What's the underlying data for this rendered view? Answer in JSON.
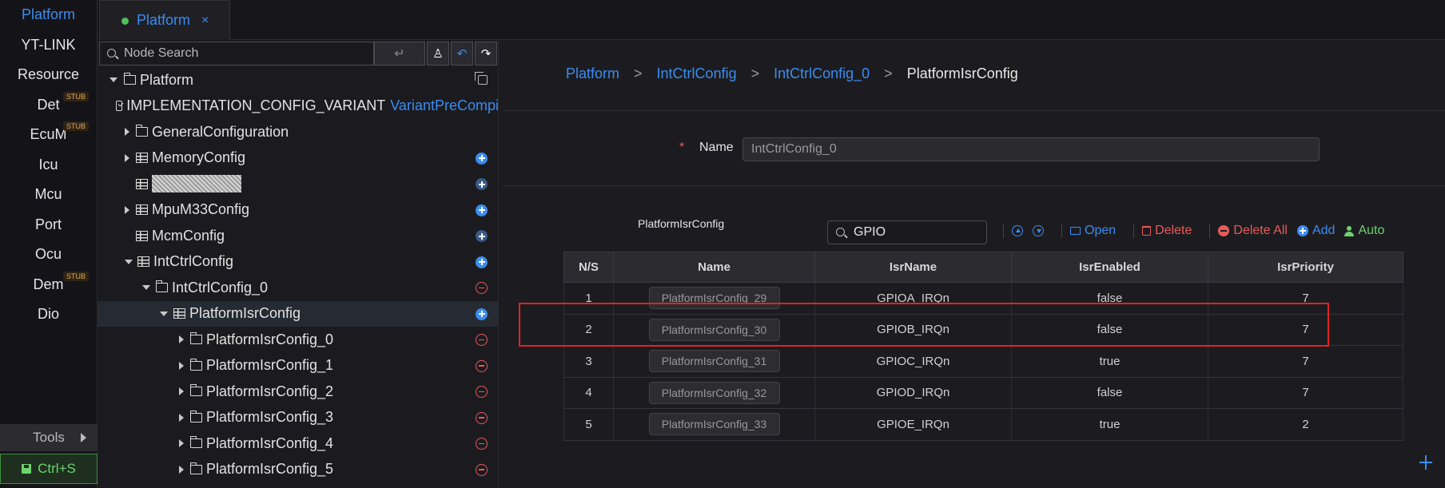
{
  "rail": {
    "items": [
      {
        "label": "Platform",
        "stub": ""
      },
      {
        "label": "YT-LINK",
        "stub": ""
      },
      {
        "label": "Resource",
        "stub": ""
      },
      {
        "label": "Det",
        "stub": "STUB"
      },
      {
        "label": "EcuM",
        "stub": "STUB"
      },
      {
        "label": "Icu",
        "stub": ""
      },
      {
        "label": "Mcu",
        "stub": ""
      },
      {
        "label": "Port",
        "stub": ""
      },
      {
        "label": "Ocu",
        "stub": ""
      },
      {
        "label": "Dem",
        "stub": "STUB"
      },
      {
        "label": "Dio",
        "stub": ""
      }
    ],
    "tools_label": "Tools",
    "save_label": "Ctrl+S"
  },
  "tabs": [
    {
      "label": "Platform",
      "close": "×"
    }
  ],
  "tree_panel": {
    "search_placeholder": "Node Search",
    "enter_glyph": "↵",
    "tree": [
      {
        "label": "Platform",
        "value": "",
        "caret": "down",
        "icon": "folder",
        "action": "copy"
      },
      {
        "label": "IMPLEMENTATION_CONFIG_VARIANT",
        "value": "VariantPreCompi",
        "caret": "",
        "icon": "check",
        "action": ""
      },
      {
        "label": "GeneralConfiguration",
        "value": "",
        "caret": "right",
        "icon": "folder",
        "action": ""
      },
      {
        "label": "MemoryConfig",
        "value": "",
        "caret": "right",
        "icon": "table",
        "action": "add"
      },
      {
        "label": "",
        "value": "",
        "caret": "",
        "icon": "table",
        "action": "add-dim"
      },
      {
        "label": "MpuM33Config",
        "value": "",
        "caret": "right",
        "icon": "table",
        "action": "add"
      },
      {
        "label": "McmConfig",
        "value": "",
        "caret": "",
        "icon": "table",
        "action": "add-dim"
      },
      {
        "label": "IntCtrlConfig",
        "value": "",
        "caret": "down",
        "icon": "table",
        "action": "add"
      },
      {
        "label": "IntCtrlConfig_0",
        "value": "",
        "caret": "down",
        "icon": "folder",
        "action": "remove"
      },
      {
        "label": "PlatformIsrConfig",
        "value": "",
        "caret": "down",
        "icon": "table",
        "action": "add"
      },
      {
        "label": "PlatformIsrConfig_0",
        "value": "",
        "caret": "right",
        "icon": "folder",
        "action": "remove"
      },
      {
        "label": "PlatformIsrConfig_1",
        "value": "",
        "caret": "right",
        "icon": "folder",
        "action": "remove"
      },
      {
        "label": "PlatformIsrConfig_2",
        "value": "",
        "caret": "right",
        "icon": "folder",
        "action": "remove"
      },
      {
        "label": "PlatformIsrConfig_3",
        "value": "",
        "caret": "right",
        "icon": "folder",
        "action": "remove"
      },
      {
        "label": "PlatformIsrConfig_4",
        "value": "",
        "caret": "right",
        "icon": "folder",
        "action": "remove"
      },
      {
        "label": "PlatformIsrConfig_5",
        "value": "",
        "caret": "right",
        "icon": "folder",
        "action": "remove"
      }
    ]
  },
  "main": {
    "breadcrumb": [
      "Platform",
      "IntCtrlConfig",
      "IntCtrlConfig_0",
      "PlatformIsrConfig"
    ],
    "breadcrumb_sep": ">",
    "name_required": "*",
    "name_label": "Name",
    "name_value": "IntCtrlConfig_0",
    "section_title": "PlatformIsrConfig",
    "filter_value": "GPIO",
    "actions": {
      "open": "Open",
      "delete": "Delete",
      "delete_all": "Delete All",
      "add": "Add",
      "auto": "Auto"
    },
    "table": {
      "columns": [
        "N/S",
        "Name",
        "IsrName",
        "IsrEnabled",
        "IsrPriority"
      ],
      "rows": [
        {
          "ns": "1",
          "name": "PlatformIsrConfig_29",
          "isr_name": "GPIOA_IRQn",
          "enabled": "false",
          "priority": "7"
        },
        {
          "ns": "2",
          "name": "PlatformIsrConfig_30",
          "isr_name": "GPIOB_IRQn",
          "enabled": "false",
          "priority": "7"
        },
        {
          "ns": "3",
          "name": "PlatformIsrConfig_31",
          "isr_name": "GPIOC_IRQn",
          "enabled": "true",
          "priority": "7"
        },
        {
          "ns": "4",
          "name": "PlatformIsrConfig_32",
          "isr_name": "GPIOD_IRQn",
          "enabled": "false",
          "priority": "7"
        },
        {
          "ns": "5",
          "name": "PlatformIsrConfig_33",
          "isr_name": "GPIOE_IRQn",
          "enabled": "true",
          "priority": "2"
        }
      ]
    }
  },
  "colors": {
    "accent": "#3b8cf0",
    "danger": "#e85a5a",
    "success": "#6ed36e",
    "highlight": "#e02424"
  }
}
